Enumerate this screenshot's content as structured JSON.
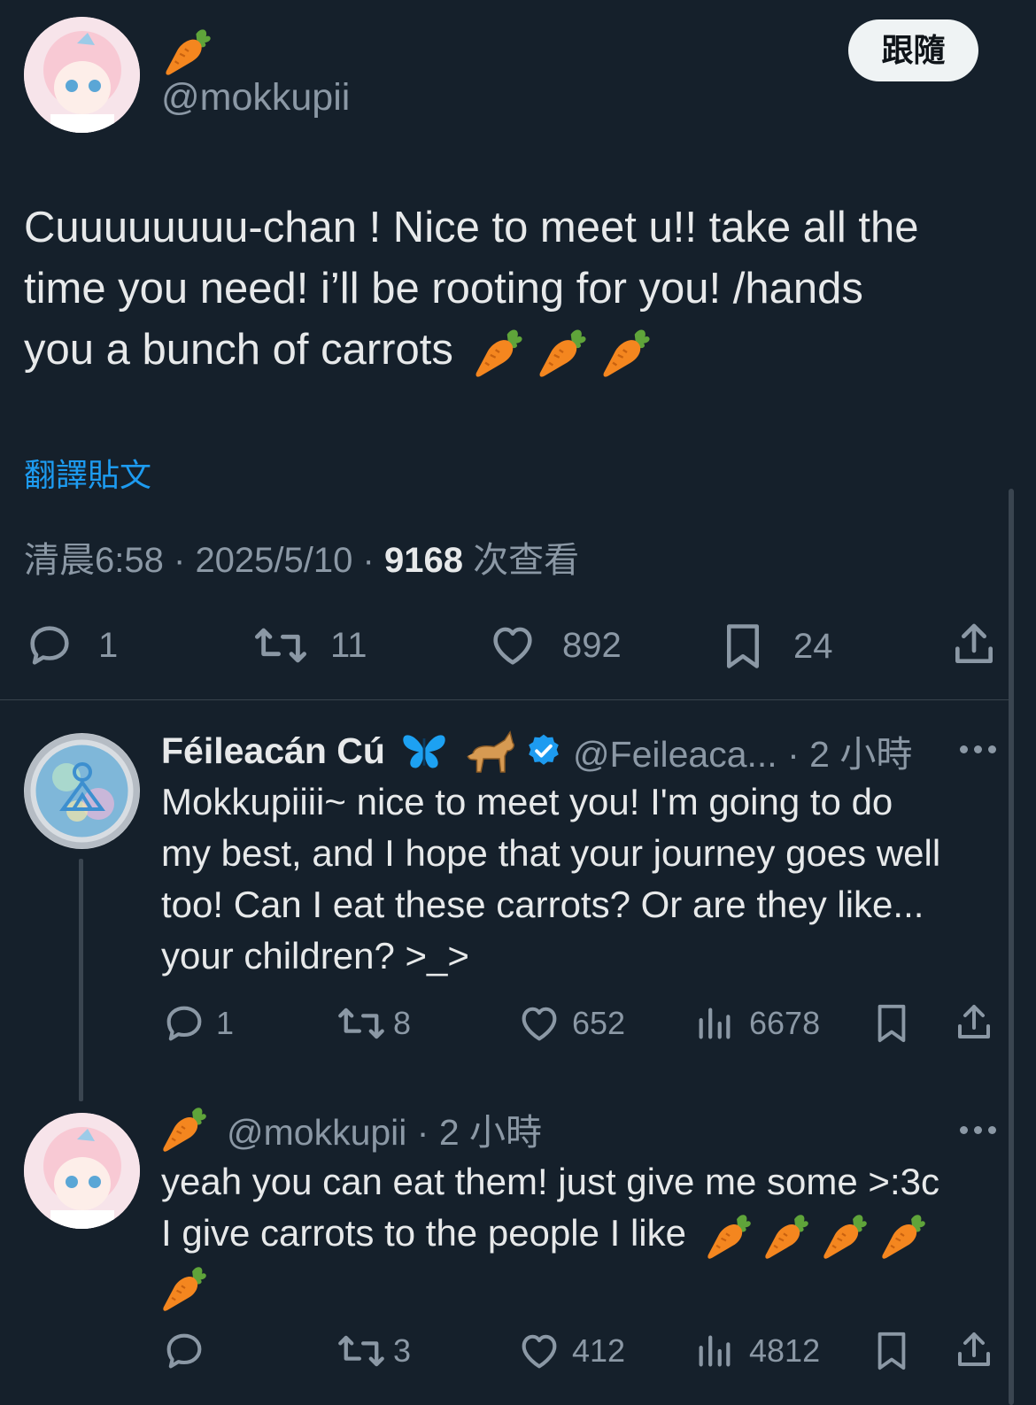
{
  "main_post": {
    "display_name_emoji": "carrot",
    "handle": "@mokkupii",
    "follow_label": "跟隨",
    "text_line1": "Cuuuuuuuu-chan ! Nice to meet u!! take all the",
    "text_line2": "time you need! i’ll be rooting for you! /hands",
    "text_line3": "you a bunch of carrots",
    "translate_label": "翻譯貼文",
    "time": "清晨6:58",
    "sep1": "·",
    "date": "2025/5/10",
    "sep2": "·",
    "views_count": "9168",
    "views_label": "次查看",
    "replies": "1",
    "reposts": "11",
    "likes": "892",
    "bookmarks": "24"
  },
  "reply1": {
    "display_name": "Féileacán Cú",
    "handle_time": "@Feileaca... · 2 小時",
    "line1": "Mokkupiiii~ nice to meet you! I'm going to do",
    "line2": "my best, and I hope that your journey goes well",
    "line3": "too! Can I eat these carrots?  Or are they like...",
    "line4": "your children? >_>",
    "replies": "1",
    "reposts": "8",
    "likes": "652",
    "views": "6678"
  },
  "reply2": {
    "handle_time": "@mokkupii · 2 小時",
    "line1": "yeah you can eat them! just give me some >:3c",
    "line2": "I give carrots to the people I like",
    "replies": "",
    "reposts": "3",
    "likes": "412",
    "views": "4812"
  },
  "colors": {
    "background": "#15202b",
    "text": "#e7e9ea",
    "muted": "#8b98a5",
    "link": "#1d9bf0",
    "verified": "#1d9bf0"
  },
  "icons": [
    "carrot-emoji",
    "reply-icon",
    "repost-icon",
    "like-icon",
    "bookmark-icon",
    "share-icon",
    "views-icon",
    "more-icon",
    "verified-badge-icon",
    "butterfly-emoji",
    "dog-emoji"
  ]
}
